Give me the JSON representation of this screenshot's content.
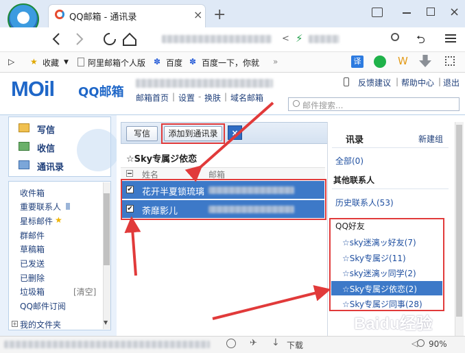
{
  "browser": {
    "tab_title": "QQ邮箱 - 通讯录",
    "new_tab": "+",
    "bookmarks": [
      "收藏",
      "阿里邮箱个人版",
      "百度",
      "百度一下，你就"
    ],
    "more": "»",
    "translate_label": "译"
  },
  "header": {
    "logo_text": "MOil",
    "logo_brand": "QQ邮箱",
    "links": [
      "反馈建议",
      "帮助中心",
      "退出"
    ],
    "nav": [
      "邮箱首页",
      "设置",
      "换肤",
      "域名邮箱"
    ],
    "search_placeholder": "邮件搜索..."
  },
  "sidebar": {
    "actions": [
      "写信",
      "收信",
      "通讯录"
    ],
    "folders": [
      "收件箱",
      "重要联系人",
      "星标邮件",
      "群邮件",
      "草稿箱",
      "已发送",
      "已删除",
      "垃圾箱",
      "QQ邮件订阅",
      "我的文件夹"
    ],
    "clear_label": "[清空]"
  },
  "toolbar": {
    "compose": "写信",
    "add_contacts": "添加到通讯录",
    "close": "×"
  },
  "group": {
    "title": "☆Sky专属ジ依恋",
    "col_name": "姓名",
    "col_email": "邮箱",
    "rows": [
      {
        "name": "花开半夏锁琉璃"
      },
      {
        "name": "荼靡影儿"
      }
    ]
  },
  "contacts": {
    "title": "讯录",
    "new_group": "新建组",
    "all": "全部(0)",
    "other_title": "其他联系人",
    "history": "历史联系人(53)",
    "qq_title": "QQ好友",
    "qq_groups": [
      "☆sky迷漓ッ好友(7)",
      "☆Sky专属ジ(11)",
      "☆sky迷漓ッ同学(2)",
      "☆Sky专属ジ依恋(2)",
      "☆Sky专属ジ同事(28)"
    ],
    "selected_index": 3
  },
  "status": {
    "download": "下载",
    "zoom": "90%"
  },
  "watermark": "Baidu经验",
  "colors": {
    "selected_row": "#3d79c8",
    "annotation": "#e13a3a",
    "link": "#1f4fa0"
  }
}
